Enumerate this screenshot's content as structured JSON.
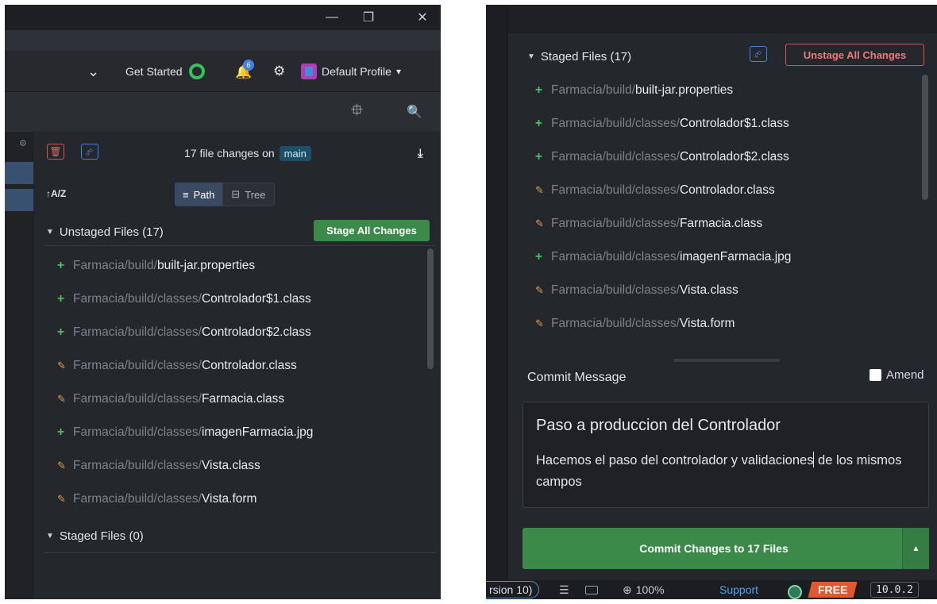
{
  "left": {
    "window_controls": {
      "minimize": "—",
      "restore": "❐",
      "close": "✕"
    },
    "toolbar": {
      "dropdown_caret": "⌄",
      "get_started": "Get Started",
      "notifications_count": "6",
      "bell_glyph": "🔔",
      "settings_glyph": "⚙",
      "profile_label": "Default Profile",
      "profile_caret": "▾"
    },
    "toolbar2": {
      "adjust_glyph": "⯐",
      "search_glyph": "🔍"
    },
    "rail_gear": "⚙",
    "header": {
      "trash_glyph": "🗑",
      "share_glyph": "⮳",
      "changes_text": "17 file changes on",
      "branch": "main",
      "download_glyph": "⤓"
    },
    "sort_glyph": "↑A/Z",
    "view_toggle": {
      "path_label": "Path",
      "path_glyph": "≡",
      "tree_label": "Tree",
      "tree_glyph": "⊟"
    },
    "unstaged": {
      "title": "Unstaged Files (17)",
      "caret": "▼",
      "stage_all_label": "Stage All Changes",
      "files": [
        {
          "status": "+",
          "kind": "added",
          "dir": "Farmacia/build/",
          "name": "built-jar.properties"
        },
        {
          "status": "+",
          "kind": "added",
          "dir": "Farmacia/build/classes/",
          "name": "Controlador$1.class"
        },
        {
          "status": "+",
          "kind": "added",
          "dir": "Farmacia/build/classes/",
          "name": "Controlador$2.class"
        },
        {
          "status": "✎",
          "kind": "modified",
          "dir": "Farmacia/build/classes/",
          "name": "Controlador.class"
        },
        {
          "status": "✎",
          "kind": "modified",
          "dir": "Farmacia/build/classes/",
          "name": "Farmacia.class"
        },
        {
          "status": "+",
          "kind": "added",
          "dir": "Farmacia/build/classes/",
          "name": "imagenFarmacia.jpg"
        },
        {
          "status": "✎",
          "kind": "modified",
          "dir": "Farmacia/build/classes/",
          "name": "Vista.class"
        },
        {
          "status": "✎",
          "kind": "modified",
          "dir": "Farmacia/build/classes/",
          "name": "Vista.form"
        }
      ]
    },
    "staged": {
      "title": "Staged Files (0)",
      "caret": "▼"
    }
  },
  "right": {
    "staged": {
      "title": "Staged Files (17)",
      "caret": "▼",
      "share_glyph": "⮳",
      "unstage_all_label": "Unstage All Changes",
      "files": [
        {
          "status": "+",
          "kind": "added",
          "dir": "Farmacia/build/",
          "name": "built-jar.properties"
        },
        {
          "status": "+",
          "kind": "added",
          "dir": "Farmacia/build/classes/",
          "name": "Controlador$1.class"
        },
        {
          "status": "+",
          "kind": "added",
          "dir": "Farmacia/build/classes/",
          "name": "Controlador$2.class"
        },
        {
          "status": "✎",
          "kind": "modified",
          "dir": "Farmacia/build/classes/",
          "name": "Controlador.class"
        },
        {
          "status": "✎",
          "kind": "modified",
          "dir": "Farmacia/build/classes/",
          "name": "Farmacia.class"
        },
        {
          "status": "+",
          "kind": "added",
          "dir": "Farmacia/build/classes/",
          "name": "imagenFarmacia.jpg"
        },
        {
          "status": "✎",
          "kind": "modified",
          "dir": "Farmacia/build/classes/",
          "name": "Vista.class"
        },
        {
          "status": "✎",
          "kind": "modified",
          "dir": "Farmacia/build/classes/",
          "name": "Vista.form"
        }
      ]
    },
    "commit": {
      "label": "Commit Message",
      "amend_label": "Amend",
      "summary": "Paso a produccion del Controlador",
      "description_before_cursor": "Hacemos el paso del controlador y validaciones",
      "description_after_cursor": " de los mismos campos",
      "button_label": "Commit Changes to 17 Files",
      "button_arrow": "▲"
    },
    "statusbar": {
      "version_fragment": "rsion 10)",
      "list_glyph": "☰",
      "zoom": "100%",
      "zoom_glyph": "⊕",
      "support": "Support",
      "free": "FREE",
      "version": "10.0.2"
    }
  }
}
